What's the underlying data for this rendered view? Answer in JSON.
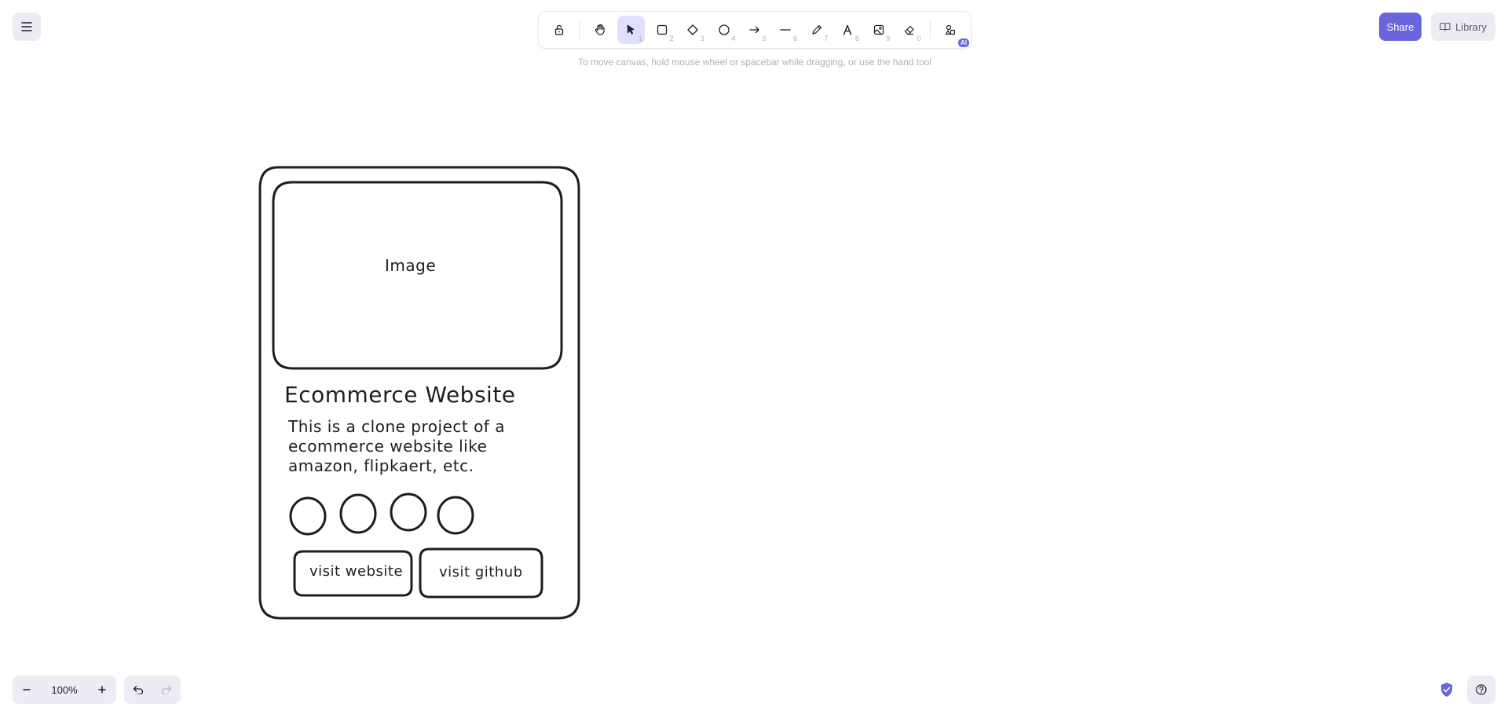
{
  "app": {
    "hint": "To move canvas, hold mouse wheel or spacebar while dragging, or use the hand tool",
    "share_label": "Share",
    "library_label": "Library",
    "zoom_level": "100%"
  },
  "toolbar": {
    "tools": [
      {
        "name": "lock",
        "key": ""
      },
      {
        "name": "hand",
        "key": ""
      },
      {
        "name": "selection",
        "key": "1"
      },
      {
        "name": "rectangle",
        "key": "2"
      },
      {
        "name": "diamond",
        "key": "3"
      },
      {
        "name": "ellipse",
        "key": "4"
      },
      {
        "name": "arrow",
        "key": "5"
      },
      {
        "name": "line",
        "key": "6"
      },
      {
        "name": "draw",
        "key": "7"
      },
      {
        "name": "text",
        "key": "8"
      },
      {
        "name": "image",
        "key": "9"
      },
      {
        "name": "eraser",
        "key": "0"
      }
    ],
    "ai_badge": "AI"
  },
  "drawing": {
    "image_label": "Image",
    "title": "Ecommerce Website",
    "description_lines": [
      "This is a clone project of a",
      "ecommerce website like",
      "amazon, flipkaert, etc."
    ],
    "button_website": "visit website",
    "button_github": "visit github"
  },
  "colors": {
    "accent": "#6965db",
    "active_tool_bg": "#e0dfff",
    "stroke": "#1e1e1e"
  }
}
